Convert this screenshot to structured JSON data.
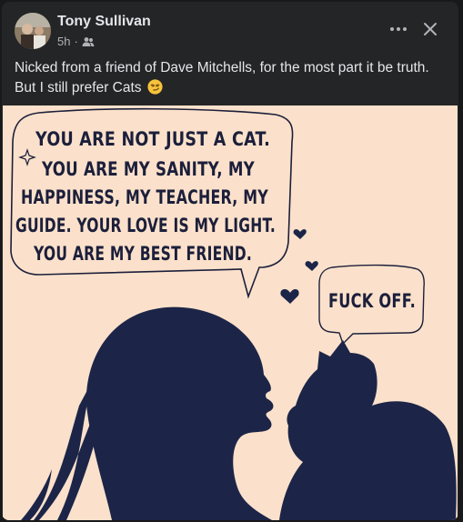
{
  "post": {
    "author": "Tony Sullivan",
    "time": "5h",
    "separator": "·",
    "audience_icon": "friends-icon",
    "caption_line1": "Nicked from a friend of Dave Mitchells, for the most part it be truth.",
    "caption_line2": "But I still prefer Cats",
    "caption_emoji": "smirk-emoji"
  },
  "actions": {
    "more_icon": "more-options-icon",
    "close_icon": "close-icon"
  },
  "image": {
    "bubble_lines": [
      "YOU ARE NOT JUST A CAT.",
      "YOU ARE MY SANITY, MY",
      "HAPPINESS, MY TEACHER, MY",
      "GUIDE. YOUR LOVE IS MY LIGHT.",
      "YOU ARE MY BEST FRIEND."
    ],
    "cat_reply": "FUCK OFF.",
    "colors": {
      "background": "#fbe1cb",
      "silhouette": "#1c2548",
      "text": "#1c1f3b"
    }
  }
}
